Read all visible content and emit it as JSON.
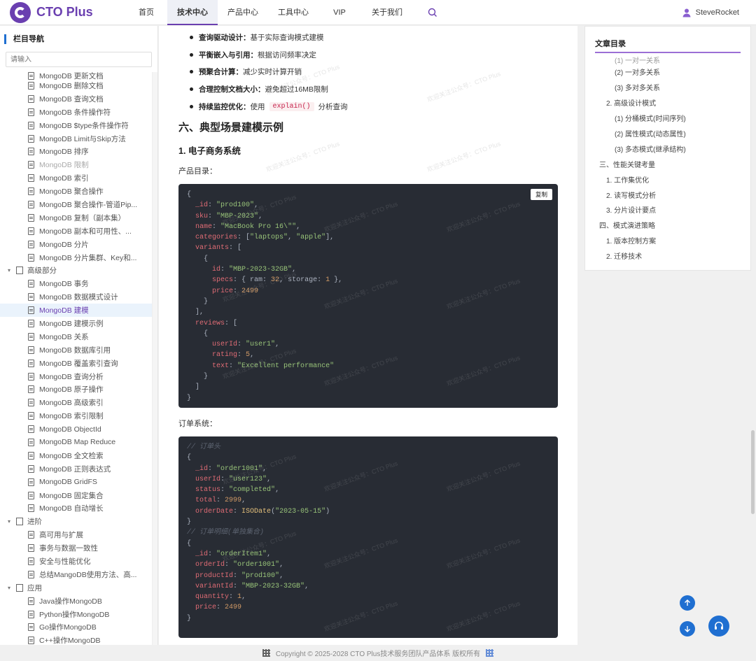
{
  "header": {
    "logo_text": "CTO Plus",
    "nav": [
      "首页",
      "技术中心",
      "产品中心",
      "工具中心",
      "VIP",
      "关于我们"
    ],
    "active_nav": "技术中心",
    "user_name": "SteveRocket"
  },
  "sidebar": {
    "title": "栏目导航",
    "search_placeholder": "请输入",
    "items": [
      {
        "type": "doc",
        "label": "MongoDB 更新文档",
        "state": "cut"
      },
      {
        "type": "doc",
        "label": "MongoDB 删除文档"
      },
      {
        "type": "doc",
        "label": "MongoDB 查询文档"
      },
      {
        "type": "doc",
        "label": "MongoDB 条件操作符"
      },
      {
        "type": "doc",
        "label": "MongoDB $type条件操作符"
      },
      {
        "type": "doc",
        "label": "MongoDB Limit与Skip方法"
      },
      {
        "type": "doc",
        "label": "MongoDB 排序"
      },
      {
        "type": "doc",
        "label": "MongoDB 限制",
        "state": "muted"
      },
      {
        "type": "doc",
        "label": "MongoDB 索引"
      },
      {
        "type": "doc",
        "label": "MongoDB 聚合操作"
      },
      {
        "type": "doc",
        "label": "MongoDB 聚合操作-管道Pip..."
      },
      {
        "type": "doc",
        "label": "MongoDB 复制（副本集）"
      },
      {
        "type": "doc",
        "label": "MongoDB 副本和可用性、..."
      },
      {
        "type": "doc",
        "label": "MongoDB 分片"
      },
      {
        "type": "doc",
        "label": "MongoDB 分片集群、Key和..."
      },
      {
        "type": "folder",
        "label": "高级部分"
      },
      {
        "type": "doc",
        "label": "MongoDB 事务"
      },
      {
        "type": "doc",
        "label": "MongoDB 数据模式设计"
      },
      {
        "type": "doc",
        "label": "MongoDB 建模",
        "state": "selected"
      },
      {
        "type": "doc",
        "label": "MongoDB 建模示例"
      },
      {
        "type": "doc",
        "label": "MongoDB 关系"
      },
      {
        "type": "doc",
        "label": "MongoDB 数据库引用"
      },
      {
        "type": "doc",
        "label": "MongoDB 覆盖索引查询"
      },
      {
        "type": "doc",
        "label": "MongoDB 查询分析"
      },
      {
        "type": "doc",
        "label": "MongoDB 原子操作"
      },
      {
        "type": "doc",
        "label": "MongoDB 高级索引"
      },
      {
        "type": "doc",
        "label": "MongoDB 索引限制"
      },
      {
        "type": "doc",
        "label": "MongoDB ObjectId"
      },
      {
        "type": "doc",
        "label": "MongoDB Map Reduce"
      },
      {
        "type": "doc",
        "label": "MongoDB 全文检索"
      },
      {
        "type": "doc",
        "label": "MongoDB 正则表达式"
      },
      {
        "type": "doc",
        "label": "MongoDB GridFS"
      },
      {
        "type": "doc",
        "label": "MongoDB 固定集合"
      },
      {
        "type": "doc",
        "label": "MongoDB 自动增长"
      },
      {
        "type": "folder",
        "label": "进阶"
      },
      {
        "type": "doc",
        "label": "高可用与扩展"
      },
      {
        "type": "doc",
        "label": "事务与数据一致性"
      },
      {
        "type": "doc",
        "label": "安全与性能优化"
      },
      {
        "type": "doc",
        "label": "总结MangoDB使用方法、高..."
      },
      {
        "type": "folder",
        "label": "应用"
      },
      {
        "type": "doc",
        "label": "Java操作MongoDB"
      },
      {
        "type": "doc",
        "label": "Python操作MongoDB"
      },
      {
        "type": "doc",
        "label": "Go操作MongoDB"
      },
      {
        "type": "doc",
        "label": "C++操作MongoDB"
      }
    ]
  },
  "article": {
    "bullets": [
      {
        "bold": "查询驱动设计：",
        "text": "基于实际查询模式建模"
      },
      {
        "bold": "平衡嵌入与引用：",
        "text": "根据访问频率决定"
      },
      {
        "bold": "预聚合计算：",
        "text": "减少实时计算开销"
      },
      {
        "bold": "合理控制文档大小：",
        "text": "避免超过16MB限制"
      },
      {
        "bold": "持续监控优化：",
        "text": "使用",
        "code": "explain()",
        "suffix": "分析查询"
      }
    ],
    "h2": "六、典型场景建模示例",
    "h3": "1. 电子商务系统",
    "label_products": "产品目录：",
    "label_orders": "订单系统：",
    "copy_label": "复制",
    "code_products": "{\n  _id: \"prod100\",\n  sku: \"MBP-2023\",\n  name: \"MacBook Pro 16\\\"\",\n  categories: [\"laptops\", \"apple\"],\n  variants: [\n    {\n      id: \"MBP-2023-32GB\",\n      specs: { ram: 32, storage: 1 },\n      price: 2499\n    }\n  ],\n  reviews: [\n    {\n      userId: \"user1\",\n      rating: 5,\n      text: \"Excellent performance\"\n    }\n  ]\n}",
    "code_orders": "// 订单头\n{\n  _id: \"order1001\",\n  userId: \"user123\",\n  status: \"completed\",\n  total: 2999,\n  orderDate: ISODate(\"2023-05-15\")\n}\n// 订单明细(单独集合)\n{\n  _id: \"orderItem1\",\n  orderId: \"order1001\",\n  productId: \"prod100\",\n  variantId: \"MBP-2023-32GB\",\n  quantity: 1,\n  price: 2499\n}",
    "watermark": "欢迎关注公众号：CTO Plus"
  },
  "toc": {
    "title": "文章目录",
    "items": [
      {
        "level": "l3",
        "label": "(1) 一对一关系",
        "state": "cut"
      },
      {
        "level": "l3",
        "label": "(2) 一对多关系"
      },
      {
        "level": "l3",
        "label": "(3) 多对多关系"
      },
      {
        "level": "l2",
        "label": "2. 高级设计模式"
      },
      {
        "level": "l3",
        "label": "(1) 分桶模式(时间序列)"
      },
      {
        "level": "l3",
        "label": "(2) 属性模式(动态属性)"
      },
      {
        "level": "l3",
        "label": "(3) 多态模式(继承结构)"
      },
      {
        "level": "l1",
        "label": "三、性能关键考量"
      },
      {
        "level": "l2",
        "label": "1. 工作集优化"
      },
      {
        "level": "l2",
        "label": "2. 读写模式分析"
      },
      {
        "level": "l2",
        "label": "3. 分片设计要点"
      },
      {
        "level": "l1",
        "label": "四、模式演进策略"
      },
      {
        "level": "l2",
        "label": "1. 版本控制方案"
      },
      {
        "level": "l2",
        "label": "2. 迁移技术"
      }
    ]
  },
  "footer": {
    "text": "Copyright © 2025-2028 CTO Plus技术服务团队产品体系 版权所有"
  },
  "colors": {
    "brand": "#6a3fb0",
    "accent": "#1f6fd1",
    "code_bg": "#282c34"
  }
}
